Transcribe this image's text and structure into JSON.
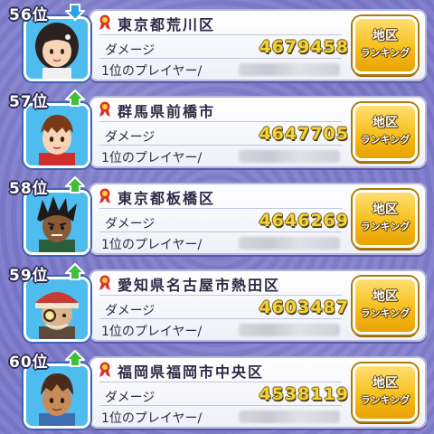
{
  "rows": [
    {
      "rank": "56位",
      "trend": "down",
      "location": "東京都荒川区",
      "damage_label": "ダメージ",
      "damage": "4679458",
      "top_player_label": "1位のプレイヤー/",
      "button_line1": "地区",
      "button_line2": "ランキング",
      "avatar": "girl-avatar"
    },
    {
      "rank": "57位",
      "trend": "up",
      "location": "群馬県前橋市",
      "damage_label": "ダメージ",
      "damage": "4647705",
      "top_player_label": "1位のプレイヤー/",
      "button_line1": "地区",
      "button_line2": "ランキング",
      "avatar": "boy-red-cap-avatar"
    },
    {
      "rank": "58位",
      "trend": "up",
      "location": "東京都板橋区",
      "damage_label": "ダメージ",
      "damage": "4646269",
      "top_player_label": "1位のプレイヤー/",
      "button_line1": "地区",
      "button_line2": "ランキング",
      "avatar": "dark-spiky-avatar"
    },
    {
      "rank": "59位",
      "trend": "up",
      "location": "愛知県名古屋市熱田区",
      "damage_label": "ダメージ",
      "damage": "4603487",
      "top_player_label": "1位のプレイヤー/",
      "button_line1": "地区",
      "button_line2": "ランキング",
      "avatar": "old-man-hat-avatar"
    },
    {
      "rank": "60位",
      "trend": "up",
      "location": "福岡県福岡市中央区",
      "damage_label": "ダメージ",
      "damage": "4538119",
      "top_player_label": "1位のプレイヤー/",
      "button_line1": "地区",
      "button_line2": "ランキング",
      "avatar": "boy-tan-avatar"
    }
  ],
  "colors": {
    "background": "#7b79c9",
    "damage_text": "#f6d237",
    "button_gold": "#f6be1b",
    "trend_up": "#3fbf3a",
    "trend_down": "#2aa3e6",
    "avatar_bg": "#4fbcef"
  }
}
